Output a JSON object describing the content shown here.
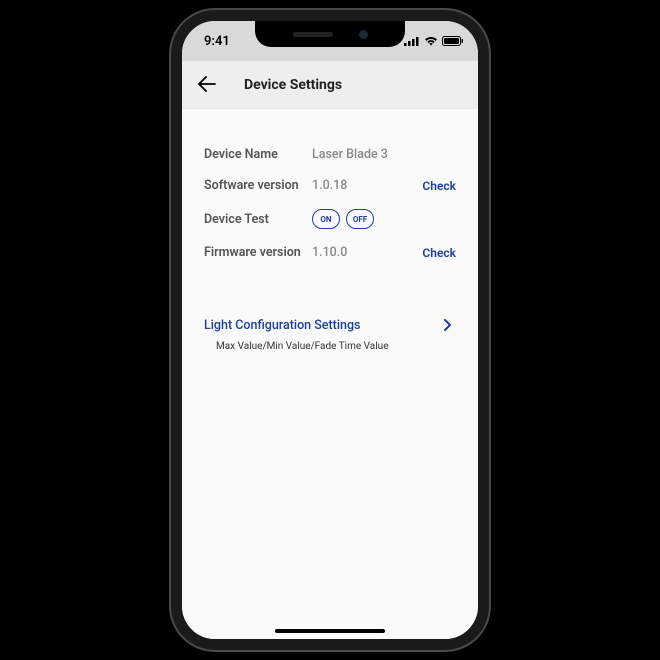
{
  "status": {
    "time": "9:41"
  },
  "header": {
    "title": "Device Settings"
  },
  "info": {
    "deviceName": {
      "label": "Device Name",
      "value": "Laser Blade 3"
    },
    "softwareVersion": {
      "label": "Software version",
      "value": "1.0.18",
      "action": "Check"
    },
    "deviceTest": {
      "label": "Device Test",
      "on": "ON",
      "off": "OFF"
    },
    "firmwareVersion": {
      "label": "Firmware version",
      "value": "1.10.0",
      "action": "Check"
    }
  },
  "lightConfig": {
    "title": "Light Configuration Settings",
    "desc": "Max Value/Min Value/Fade Time Value"
  }
}
